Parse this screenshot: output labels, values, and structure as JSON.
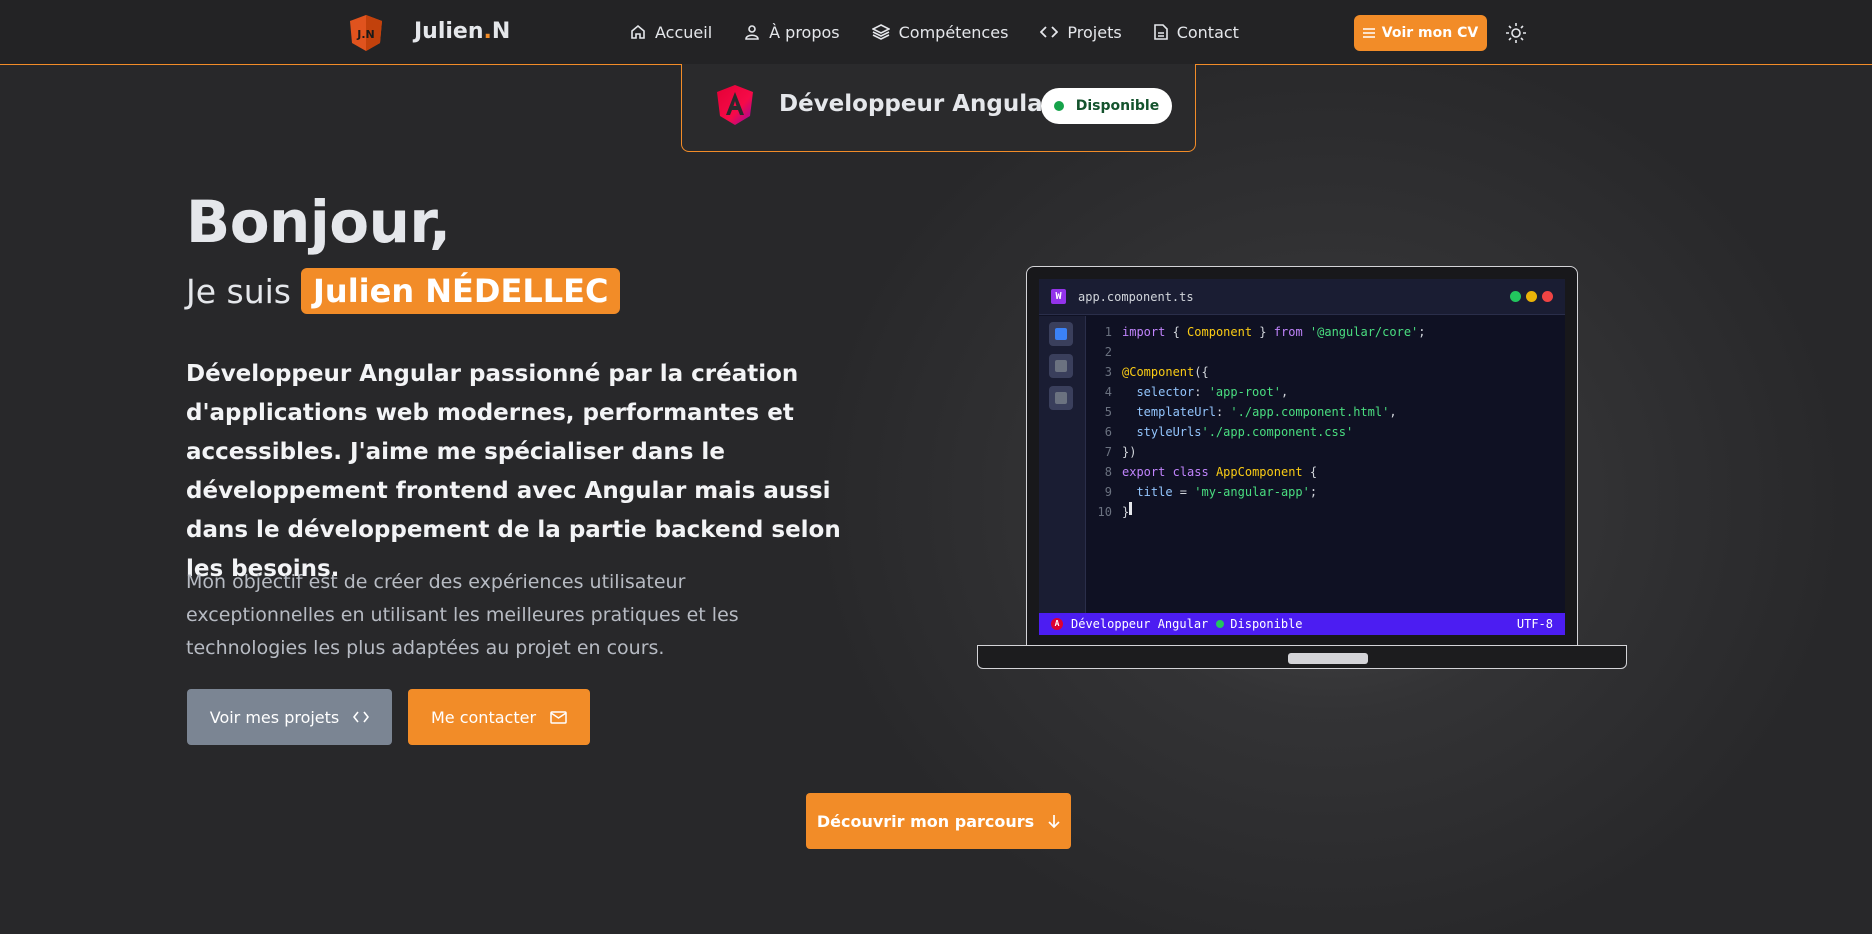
{
  "header": {
    "logo_initials": "J.N",
    "logo_name": "Julien",
    "logo_dot": ".",
    "logo_suffix": "N",
    "nav": [
      {
        "label": "Accueil",
        "icon": "home-icon"
      },
      {
        "label": "À propos",
        "icon": "user-icon"
      },
      {
        "label": "Compétences",
        "icon": "layers-icon"
      },
      {
        "label": "Projets",
        "icon": "code-icon"
      },
      {
        "label": "Contact",
        "icon": "document-icon"
      }
    ],
    "cv_button": "Voir mon CV",
    "theme_icon": "sun-icon"
  },
  "badge": {
    "title": "Développeur Angular",
    "status": "Disponible",
    "status_color": "#16a34a"
  },
  "hero": {
    "greeting": "Bonjour,",
    "intro": "Je suis",
    "name": "Julien NÉDELLEC",
    "description": "Développeur Angular passionné par la création d'applications web modernes, performantes et accessibles. J'aime me spécialiser dans le développement frontend avec Angular mais aussi dans le développement de la partie backend selon les besoins.",
    "objective": "Mon objectif est de créer des expériences utilisateur exceptionnelles en utilisant les meilleures pratiques et les technologies les plus adaptées au projet en cours.",
    "btn_projects": "Voir mes projets",
    "btn_contact": "Me contacter",
    "btn_journey": "Découvrir mon parcours"
  },
  "editor": {
    "tab_icon_letter": "W",
    "filename": "app.component.ts",
    "line_numbers": [
      "1",
      "2",
      "3",
      "4",
      "5",
      "6",
      "7",
      "8",
      "9",
      "10"
    ],
    "statusbar_left": "Développeur Angular",
    "statusbar_status": "Disponible",
    "statusbar_encoding": "UTF-8",
    "statusbar_logo": "A"
  },
  "colors": {
    "accent": "#f28c28",
    "statusbar": "#4c1df2",
    "angular": "#dd0031"
  }
}
